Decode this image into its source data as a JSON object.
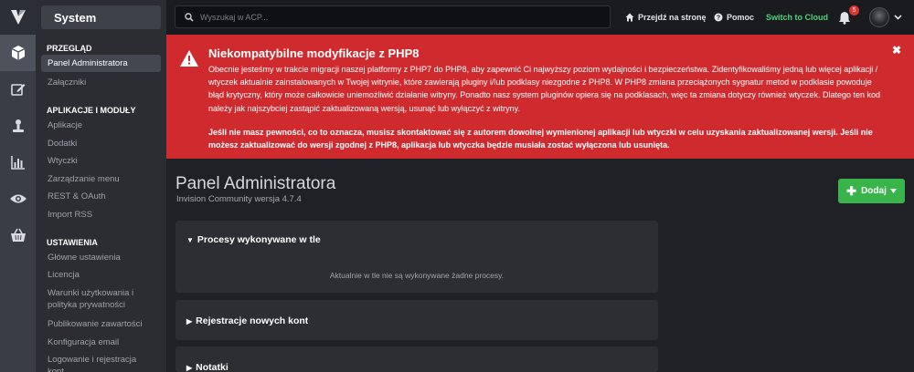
{
  "rail": {
    "icons": [
      "cube-icon",
      "edit-icon",
      "user-icon",
      "chart-icon",
      "eye-icon",
      "basket-icon"
    ]
  },
  "sidebar": {
    "system_label": "System",
    "sections": [
      {
        "heading": "PRZEGLĄD",
        "items": [
          "Panel Administratora",
          "Załączniki"
        ]
      },
      {
        "heading": "APLIKACJE I MODUŁY",
        "items": [
          "Aplikacje",
          "Dodatki",
          "Wtyczki",
          "Zarządzanie menu",
          "REST & OAuth",
          "Import RSS"
        ]
      },
      {
        "heading": "USTAWIENIA",
        "items": [
          "Główne ustawienia",
          "Licencja",
          "Warunki użytkowania i polityka prywatności",
          "Publikowanie zawartości",
          "Konfiguracja email",
          "Logowanie i rejestracja kont"
        ]
      }
    ]
  },
  "topbar": {
    "search_placeholder": "Wyszukaj w ACP...",
    "view_site": "Przejdź na stronę",
    "help": "Pomoc",
    "switch_cloud": "Switch to Cloud",
    "notification_count": "5"
  },
  "alert": {
    "title": "Niekompatybilne modyfikacje z PHP8",
    "body": "Obecnie jesteśmy w trakcie migracji naszej platformy z PHP7 do PHP8, aby zapewnić Ci najwyższy poziom wydajności i bezpieczeństwa. Zidentyfikowaliśmy jedną lub więcej aplikacji / wtyczek aktualnie zainstalowanych w Twojej witrynie, które zawierają pluginy i/lub podklasy niezgodne z PHP8. W PHP8 zmiana przeciążonych sygnatur metod w podklasie powoduje błąd krytyczny, który może całkowicie uniemożliwić działanie witryny. Ponadto nasz system pluginów opiera się na podklasach, więc ta zmiana dotyczy również wtyczek. Dlatego ten kod należy jak najszybciej zastąpić zaktualizowaną wersją, usunąć lub wyłączyć z witryny.",
    "bold_text": "Jeśli nie masz pewności, co to oznacza, musisz skontaktować się z autorem dowolnej wymienionej aplikacji lub wtyczki w celu uzyskania zaktualizowanej wersji. Jeśli nie możesz zaktualizować do wersji zgodnej z PHP8, aplikacja lub wtyczka będzie musiała zostać wyłączona lub usunięta.",
    "color": "#cf2b2f"
  },
  "main": {
    "title": "Panel Administratora",
    "version": "Invision Community wersja 4.7.4",
    "add_button": "Dodaj",
    "panels": [
      {
        "title": "Procesy wykonywane w tle",
        "expanded": true,
        "empty_text": "Aktualnie w tle nie są wykonywane żadne procesy."
      },
      {
        "title": "Rejestracje nowych kont",
        "expanded": false
      },
      {
        "title": "Notatki",
        "expanded": false
      }
    ]
  }
}
